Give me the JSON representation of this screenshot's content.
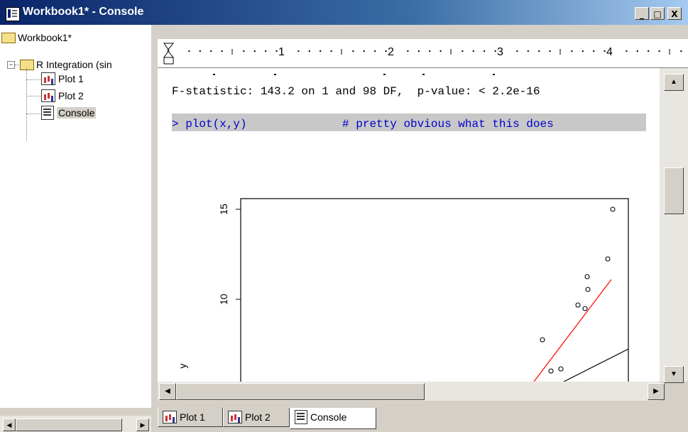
{
  "window": {
    "title": "Workbook1* - Console",
    "buttons": {
      "minimize": "_",
      "maximize": "□",
      "close": "X"
    }
  },
  "tree": {
    "root": "Workbook1*",
    "folder": "R Integration (sin",
    "items": [
      "Plot 1",
      "Plot 2",
      "Console"
    ]
  },
  "ruler": {
    "marks": [
      "1",
      "2",
      "3",
      "4"
    ]
  },
  "console": {
    "lines": [
      "F-statistic: 143.2 on 1 and 98 DF,  p-value: < 2.2e-16",
      "> plot(x,y)              # pretty obvious what this does"
    ]
  },
  "plot": {
    "y_ticks": [
      "15",
      "10"
    ],
    "y_label": "y"
  },
  "chart_data": {
    "type": "scatter",
    "y_ticks": [
      15,
      10
    ],
    "ylabel": "y",
    "points_note": "",
    "points": [
      [
        14.7,
        0
      ],
      [
        12.1,
        0
      ],
      [
        11.1,
        0
      ],
      [
        10.5,
        0
      ],
      [
        9.7,
        0
      ],
      [
        9.6,
        0
      ],
      [
        7.9,
        0
      ],
      [
        6.4,
        0
      ],
      [
        6.3,
        0
      ]
    ]
  },
  "tabs": [
    "Plot 1",
    "Plot 2",
    "Console"
  ],
  "colors": {
    "title_bar": "#0a246a",
    "command": "#0000cc",
    "regression_line": "#ff0000",
    "highlight": "#c8c8c8"
  }
}
